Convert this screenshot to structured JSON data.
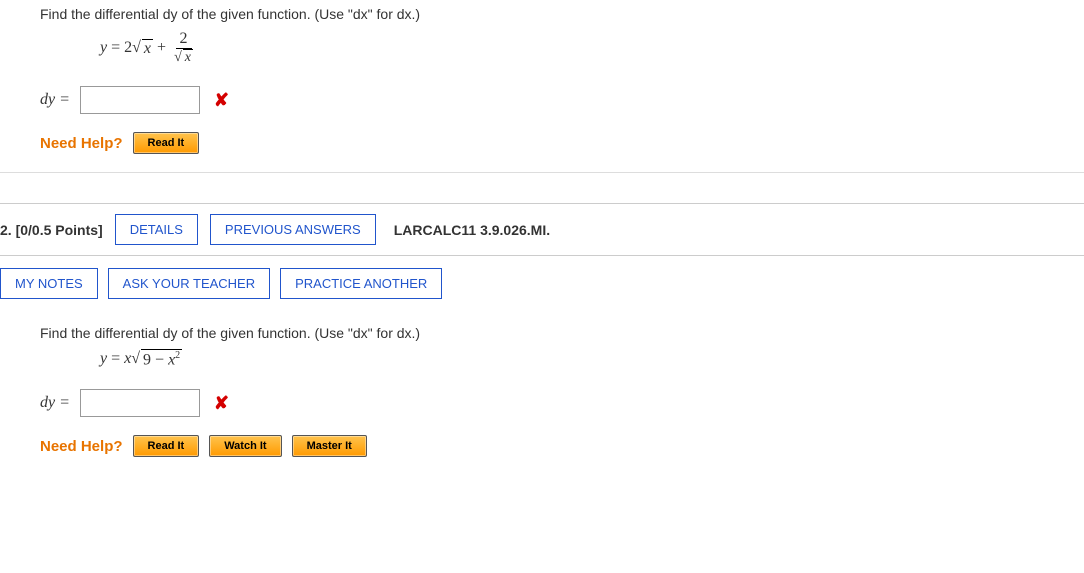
{
  "q1": {
    "prompt": "Find the differential dy of the given function. (Use \"dx\" for dx.)",
    "label_dy": "dy =",
    "help_label": "Need Help?",
    "read_it": "Read It"
  },
  "header2": {
    "points": "2. [0/0.5 Points]",
    "details": "DETAILS",
    "previous": "PREVIOUS ANSWERS",
    "source": "LARCALC11 3.9.026.MI."
  },
  "subheader2": {
    "notes": "MY NOTES",
    "ask": "ASK YOUR TEACHER",
    "practice": "PRACTICE ANOTHER"
  },
  "q2": {
    "prompt": "Find the differential dy of the given function. (Use \"dx\" for dx.)",
    "label_dy": "dy =",
    "help_label": "Need Help?",
    "read_it": "Read It",
    "watch_it": "Watch It",
    "master_it": "Master It"
  }
}
